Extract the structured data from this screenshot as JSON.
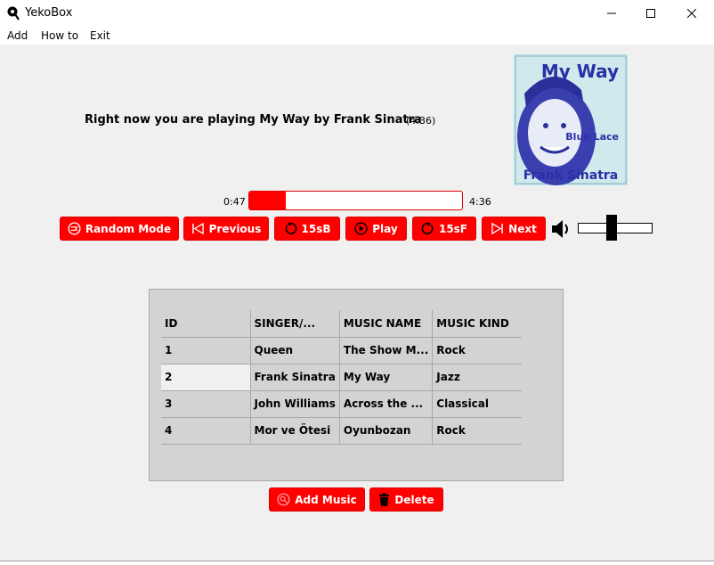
{
  "window": {
    "title": "YekoBox"
  },
  "menu": [
    {
      "label": "Add"
    },
    {
      "label": "How to"
    },
    {
      "label": "Exit"
    }
  ],
  "player": {
    "now_playing": "Right now you are playing My Way by Frank Sinatra",
    "duration_label": "(4:36)",
    "current_time": "0:47",
    "total_time": "4:36",
    "progress_fraction": 0.17,
    "volume_fraction": 0.45,
    "cover": {
      "title": "My Way",
      "subtitle": "Blue Lace",
      "artist": "Frank Sinatra"
    }
  },
  "controls": [
    {
      "label": "Random Mode",
      "icon": "shuffle-icon"
    },
    {
      "label": "Previous",
      "icon": "skip-previous-icon"
    },
    {
      "label": "15sB",
      "icon": "rewind-icon"
    },
    {
      "label": "Play",
      "icon": "play-icon"
    },
    {
      "label": "15sF",
      "icon": "forward-icon"
    },
    {
      "label": "Next",
      "icon": "skip-next-icon"
    }
  ],
  "table": {
    "columns": [
      "ID",
      "SINGER/...",
      "MUSIC NAME",
      "MUSIC KIND"
    ],
    "rows": [
      [
        "1",
        "Queen",
        "The Show M...",
        "Rock"
      ],
      [
        "2",
        "Frank Sinatra",
        "My Way",
        "Jazz"
      ],
      [
        "3",
        "John Williams",
        "Across the ...",
        "Classical"
      ],
      [
        "4",
        "Mor ve Ötesi",
        "Oyunbozan",
        "Rock"
      ]
    ]
  },
  "actions": [
    {
      "label": "Add Music",
      "icon": "add-music-icon"
    },
    {
      "label": "Delete",
      "icon": "trash-icon"
    }
  ],
  "colors": {
    "accent": "#ff0000",
    "panel": "#d3d3d3",
    "background": "#f0f0f0"
  }
}
